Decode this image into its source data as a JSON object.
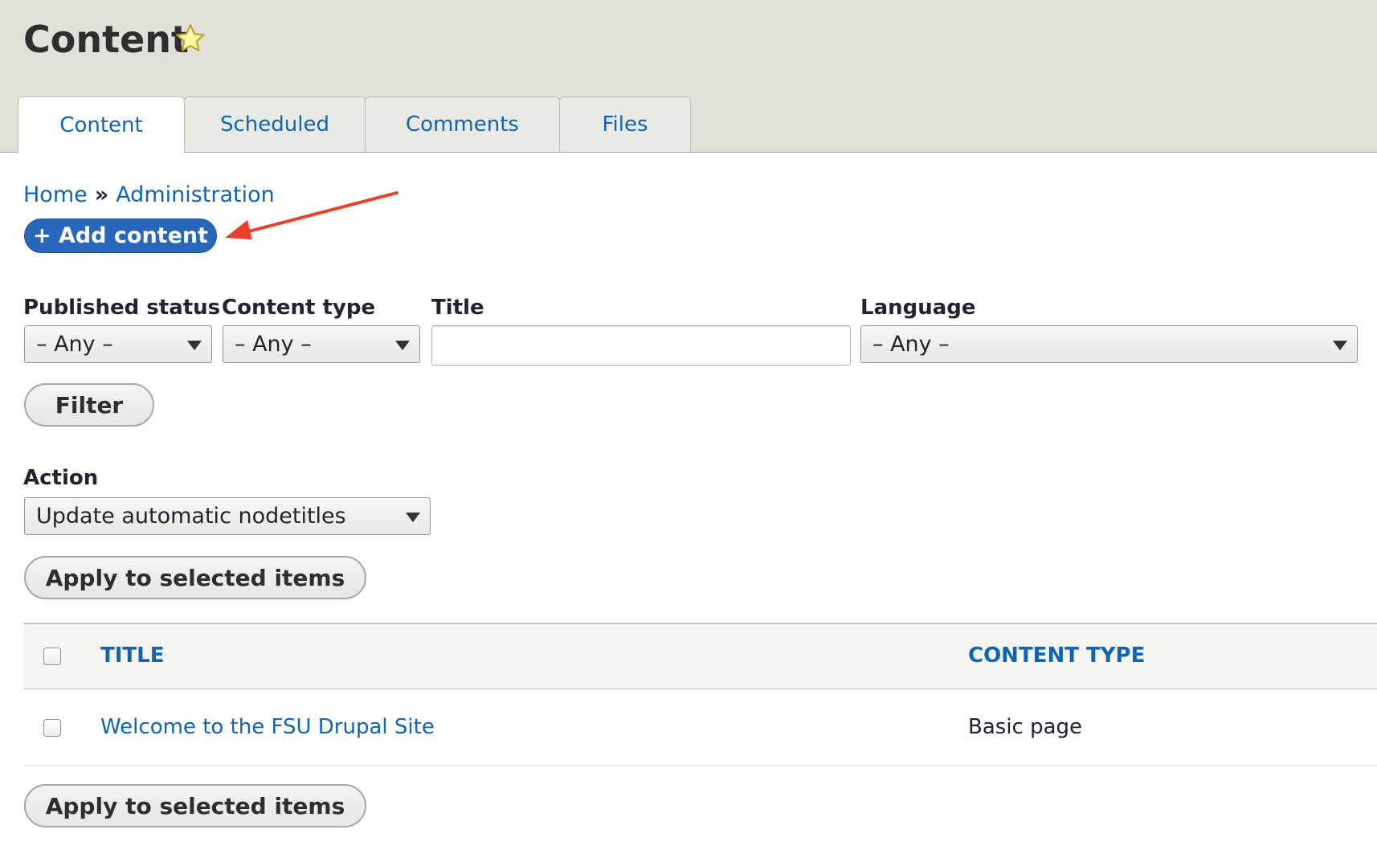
{
  "header": {
    "title": "Content",
    "tabs": [
      {
        "label": "Content",
        "active": true
      },
      {
        "label": "Scheduled",
        "active": false
      },
      {
        "label": "Comments",
        "active": false
      },
      {
        "label": "Files",
        "active": false
      }
    ]
  },
  "breadcrumb": {
    "home": "Home",
    "separator": "»",
    "administration": "Administration"
  },
  "add_content": {
    "label": "+ Add content"
  },
  "filters": {
    "published_status": {
      "label": "Published status",
      "value": "– Any –"
    },
    "content_type": {
      "label": "Content type",
      "value": "– Any –"
    },
    "title": {
      "label": "Title",
      "value": ""
    },
    "language": {
      "label": "Language",
      "value": "– Any –"
    },
    "filter_button": "Filter"
  },
  "action": {
    "label": "Action",
    "value": "Update automatic nodetitles",
    "apply_label": "Apply to selected items"
  },
  "table": {
    "columns": [
      "TITLE",
      "CONTENT TYPE"
    ],
    "rows": [
      {
        "title": "Welcome to the FSU Drupal Site",
        "content_type": "Basic page"
      }
    ]
  },
  "icons": {
    "star": "star-icon",
    "caret": "caret-down-icon"
  },
  "colors": {
    "link": "#0f64b4",
    "primary_button": "#2766b8",
    "header_bg": "#e1e1da",
    "annotation_arrow": "#e8412c"
  }
}
